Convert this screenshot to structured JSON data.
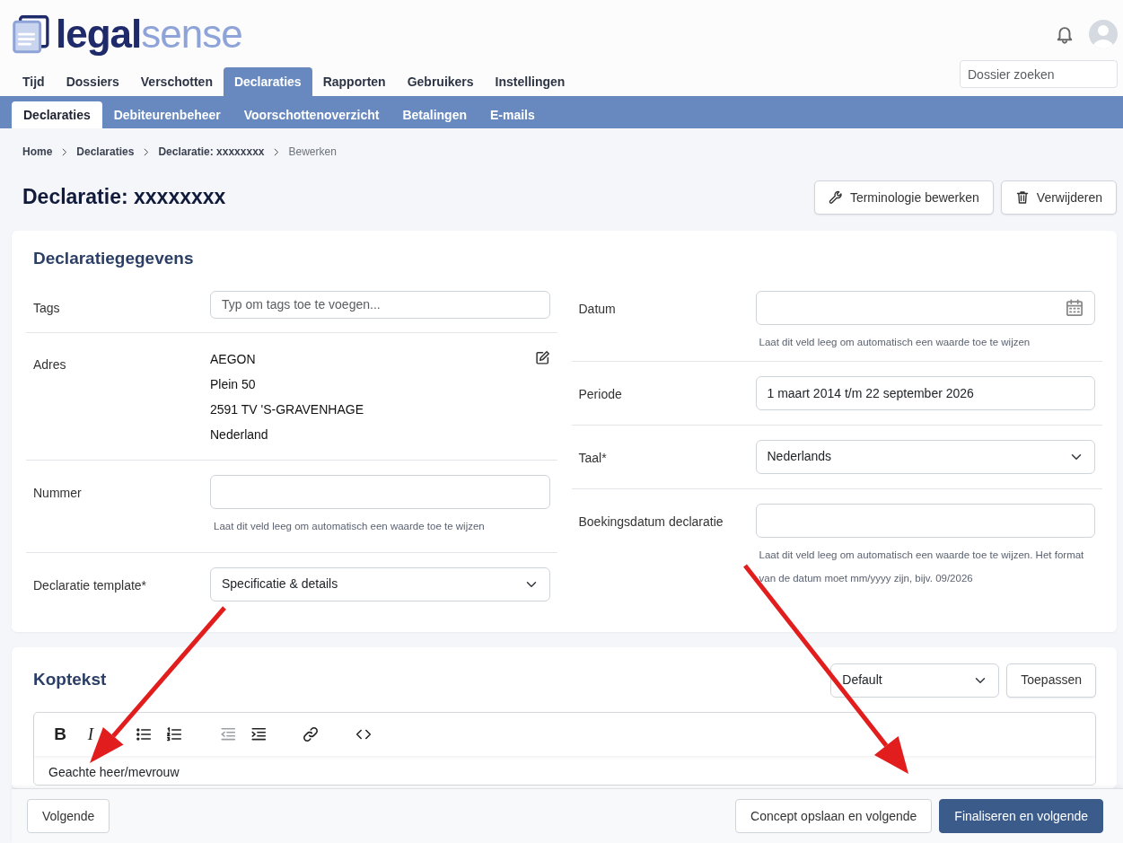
{
  "logo": {
    "part_1": "legal",
    "part_2": "sense"
  },
  "search": {
    "placeholder": "Dossier zoeken"
  },
  "main_tabs": [
    {
      "label": "Tijd",
      "selected": false
    },
    {
      "label": "Dossiers",
      "selected": false
    },
    {
      "label": "Verschotten",
      "selected": false
    },
    {
      "label": "Declaraties",
      "selected": true
    },
    {
      "label": "Rapporten",
      "selected": false
    },
    {
      "label": "Gebruikers",
      "selected": false
    },
    {
      "label": "Instellingen",
      "selected": false
    }
  ],
  "sub_tabs": [
    {
      "label": "Declaraties",
      "selected": true
    },
    {
      "label": "Debiteurenbeheer",
      "selected": false
    },
    {
      "label": "Voorschottenoverzicht",
      "selected": false
    },
    {
      "label": "Betalingen",
      "selected": false
    },
    {
      "label": "E-mails",
      "selected": false
    }
  ],
  "breadcrumb": [
    "Home",
    "Declaraties",
    "Declaratie: xxxxxxxx",
    "Bewerken"
  ],
  "title": "Declaratie: xxxxxxxx",
  "actions": [
    {
      "label": "Terminologie bewerken",
      "kind": "wrench"
    },
    {
      "label": "Verwijderen",
      "kind": "trash"
    }
  ],
  "details": {
    "title": "Declaratiegegevens",
    "left": [
      {
        "kind": "tags",
        "label": "Tags",
        "placeholder": "Typ om tags toe te voegen..."
      },
      {
        "kind": "address",
        "label": "Adres",
        "lines": [
          "AEGON",
          "Plein 50",
          "2591 TV 'S-GRAVENHAGE",
          "Nederland"
        ]
      },
      {
        "kind": "text",
        "label": "Nummer",
        "help": "Laat dit veld leeg om automatisch een waarde toe te wijzen"
      },
      {
        "kind": "select",
        "label": "Declaratie template*",
        "value": "Specificatie & details"
      }
    ],
    "right": [
      {
        "kind": "date",
        "label": "Datum",
        "help": "Laat dit veld leeg om automatisch een waarde toe te wijzen"
      },
      {
        "kind": "text",
        "label": "Periode",
        "value": "1 maart 2014 t/m 22 september 2026"
      },
      {
        "kind": "select",
        "label": "Taal*",
        "value": "Nederlands"
      },
      {
        "kind": "text",
        "label": "Boekingsdatum declaratie",
        "help": "Laat dit veld leeg om automatisch een waarde toe te wijzen. Het format van de datum moet mm/yyyy zijn, bijv. 09/2026"
      }
    ]
  },
  "header_text": {
    "title": "Koptekst",
    "template": "Default",
    "apply": "Toepassen",
    "toolbar": [
      {
        "kind": "bold",
        "label": "B",
        "disabled": false
      },
      {
        "kind": "italic",
        "label": "I",
        "disabled": false
      },
      {
        "kind": "bullets",
        "disabled": false
      },
      {
        "kind": "numbers",
        "disabled": false
      },
      {
        "kind": "outdent",
        "disabled": true
      },
      {
        "kind": "indent",
        "disabled": false
      },
      {
        "kind": "link",
        "disabled": false
      },
      {
        "kind": "code",
        "disabled": false
      }
    ],
    "content": "Geachte heer/mevrouw"
  },
  "footer": [
    {
      "label": "Volgende",
      "kind": "outline"
    },
    {
      "label": "Concept opslaan en volgende",
      "kind": "outline"
    },
    {
      "label": "Finaliseren en volgende",
      "kind": "primary"
    }
  ],
  "annotations": [
    {
      "kind": "arrow"
    },
    {
      "kind": "arrow"
    }
  ]
}
